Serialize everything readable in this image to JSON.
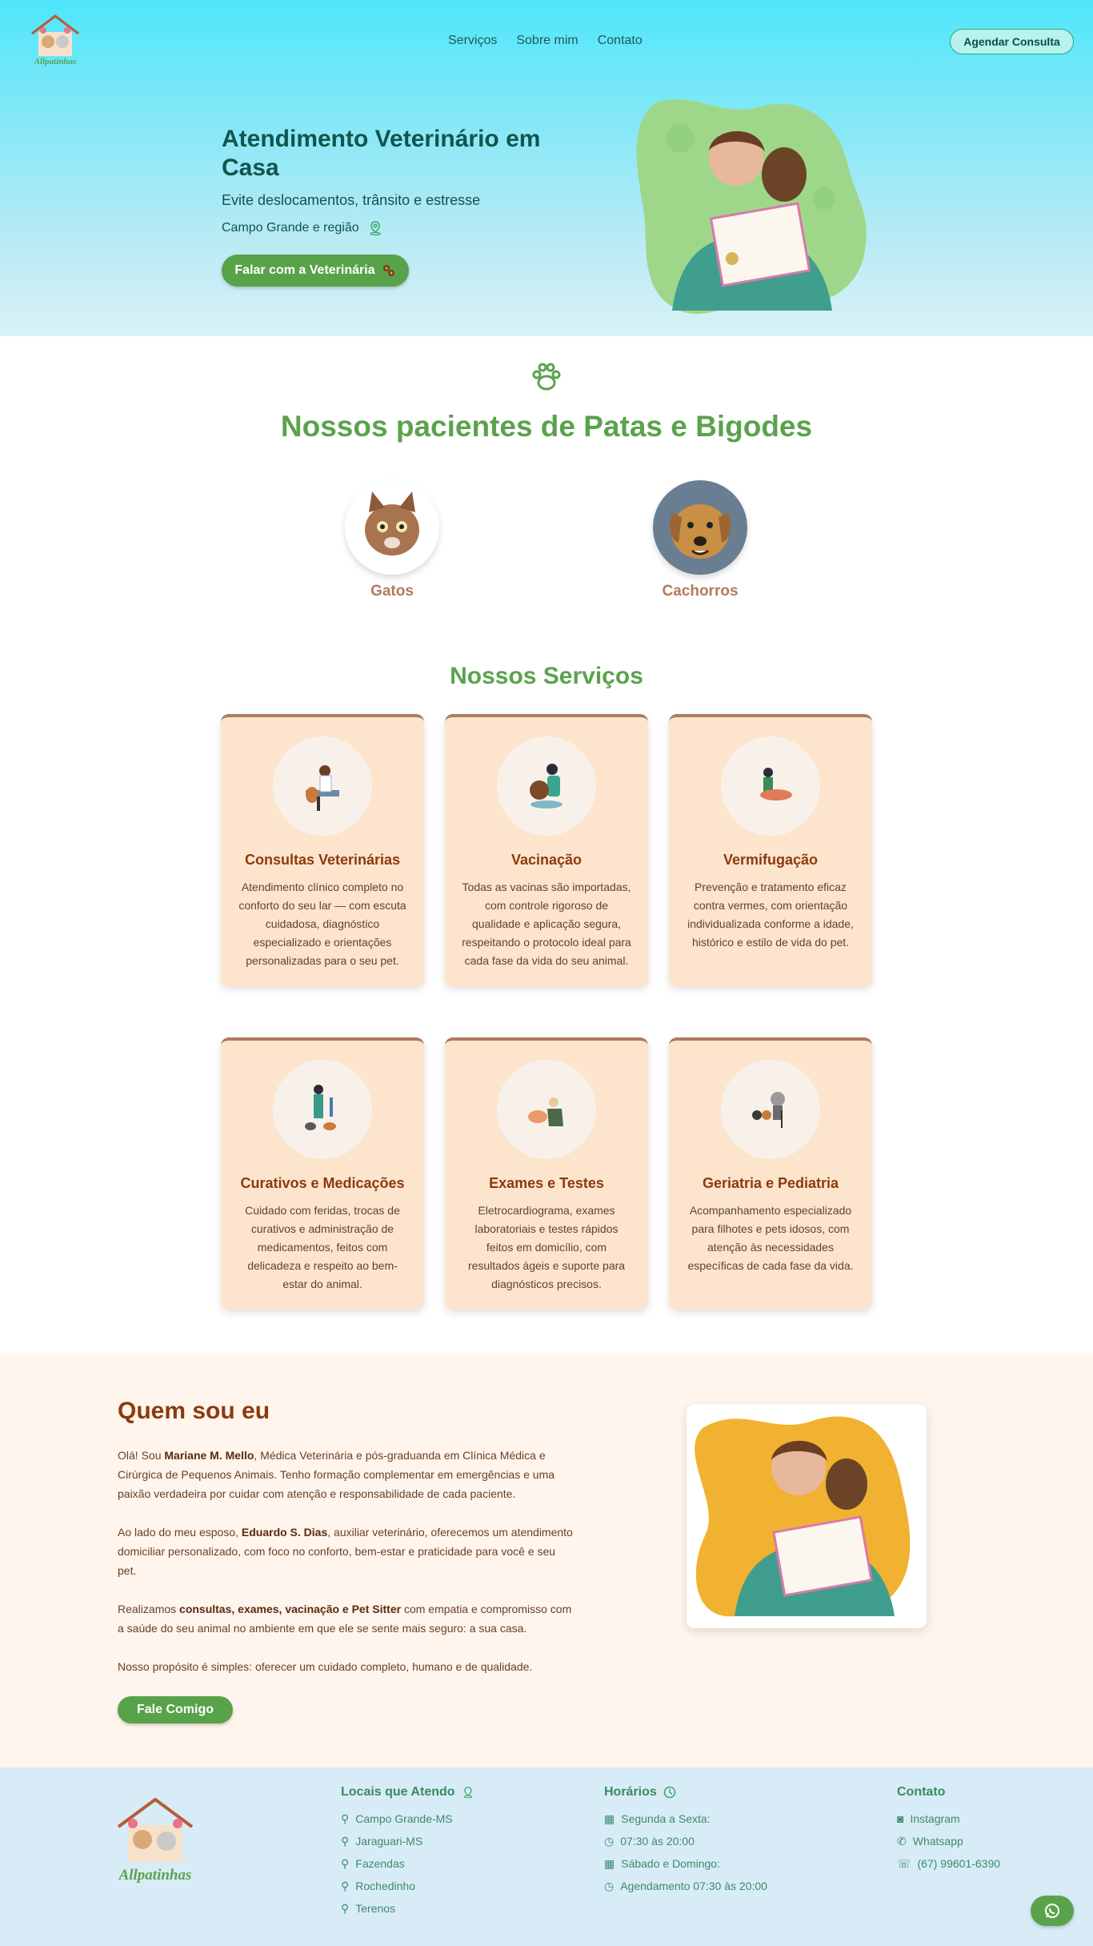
{
  "header": {
    "logo_text": "Allpatinhas",
    "nav": [
      "Serviços",
      "Sobre mim",
      "Contato"
    ],
    "cta": "Agendar Consulta"
  },
  "hero": {
    "title": "Atendimento Veterinário em Casa",
    "subtitle": "Evite deslocamentos, trânsito e estresse",
    "location": "Campo Grande e região",
    "button": "Falar com a Veterinária"
  },
  "patients": {
    "title": "Nossos pacientes de Patas e Bigodes",
    "items": [
      "Gatos",
      "Cachorros"
    ]
  },
  "services": {
    "title": "Nossos Serviços",
    "items": [
      {
        "title": "Consultas Veterinárias",
        "text": "Atendimento clínico completo no conforto do seu lar — com escuta cuidadosa, diagnóstico especializado e orientações personalizadas para o seu pet.",
        "icon": "vet-consult-icon"
      },
      {
        "title": "Vacinação",
        "text": "Todas as vacinas são importadas, com controle rigoroso de qualidade e aplicação segura, respeitando o protocolo ideal para cada fase da vida do seu animal.",
        "icon": "vaccination-icon"
      },
      {
        "title": "Vermifugação",
        "text": "Prevenção e tratamento eficaz contra vermes, com orientação individualizada conforme a idade, histórico e estilo de vida do pet.",
        "icon": "deworming-icon"
      },
      {
        "title": "Curativos e Medicações",
        "text": "Cuidado com feridas, trocas de curativos e administração de medicamentos, feitos com delicadeza e respeito ao bem-estar do animal.",
        "icon": "medication-icon"
      },
      {
        "title": "Exames e Testes",
        "text": "Eletrocardiograma, exames laboratoriais e testes rápidos feitos em domicílio, com resultados ágeis e suporte para diagnósticos precisos.",
        "icon": "exams-icon"
      },
      {
        "title": "Geriatria e Pediatria",
        "text": "Acompanhamento especializado para filhotes e pets idosos, com atenção às necessidades específicas de cada fase da vida.",
        "icon": "geriatrics-icon"
      }
    ]
  },
  "about": {
    "title": "Quem sou eu",
    "p1_a": "Olá! Sou ",
    "p1_b": "Mariane M. Mello",
    "p1_c": ", Médica Veterinária e pós-graduanda em Clínica Médica e Cirúrgica de Pequenos Animais. Tenho formação complementar em emergências e uma paixão verdadeira por cuidar com atenção e responsabilidade de cada paciente.",
    "p2_a": "Ao lado do meu esposo, ",
    "p2_b": "Eduardo S. Dias",
    "p2_c": ", auxiliar veterinário, oferecemos um atendimento domiciliar personalizado, com foco no conforto, bem-estar e praticidade para você e seu pet.",
    "p3_a": "Realizamos ",
    "p3_b": "consultas, exames, vacinação e Pet Sitter",
    "p3_c": " com empatia e compromisso com a saúde do seu animal no ambiente em que ele se sente mais seguro: a sua casa.",
    "p4": "Nosso propósito é simples: oferecer um cuidado completo, humano e de qualidade.",
    "button": "Fale Comigo"
  },
  "footer": {
    "locations_title": "Locais que Atendo",
    "locations": [
      "Campo Grande-MS",
      "Jaraguari-MS",
      "Fazendas",
      "Rochedinho",
      "Terenos"
    ],
    "hours_title": "Horários",
    "hours": [
      "Segunda a Sexta:",
      "07:30 às 20:00",
      "Sábado e Domingo:",
      "Agendamento 07:30 às 20:00"
    ],
    "contact_title": "Contato",
    "contact": [
      "Instagram",
      "Whatsapp",
      "(67) 99601-6390"
    ]
  }
}
